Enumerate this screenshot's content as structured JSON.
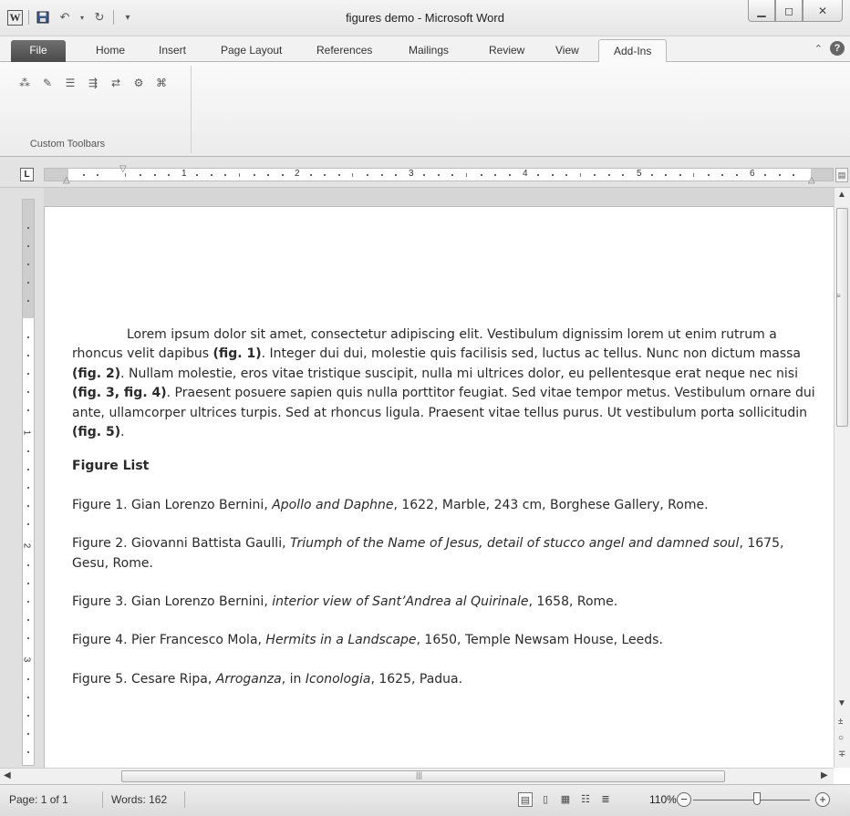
{
  "window": {
    "title": "figures demo - Microsoft Word",
    "app_icon_letter": "W",
    "controls": {
      "minimize": "—",
      "maximize": "▢",
      "close": "✕"
    }
  },
  "quick_access": {
    "save_icon": "save-icon",
    "undo_icon": "undo-icon",
    "redo_icon": "redo-icon",
    "customize_icon": "customize-icon"
  },
  "ribbon": {
    "tabs": [
      "File",
      "Home",
      "Insert",
      "Page Layout",
      "References",
      "Mailings",
      "Review",
      "View",
      "Add-Ins"
    ],
    "active_tab": "Add-Ins",
    "group": {
      "label": "Custom Toolbars"
    },
    "tools": [
      "tool-1-icon",
      "tool-2-icon",
      "tool-3-icon",
      "tool-4-icon",
      "tool-5-icon",
      "tool-6-icon",
      "tool-7-icon"
    ]
  },
  "ruler": {
    "numbers": [
      "1",
      "2",
      "3",
      "4",
      "5",
      "6"
    ],
    "vertical_numbers": [
      "1",
      "2",
      "3"
    ],
    "tab_selector": "L"
  },
  "document": {
    "paragraph": {
      "p1": "Lorem ipsum dolor sit amet, consectetur adipiscing elit. Vestibulum dignissim lorem ut enim rutrum a rhoncus velit dapibus ",
      "ref1": "(fig. 1)",
      "p2": ". Integer dui dui, molestie quis facilisis sed, luctus ac tellus. Nunc non dictum massa ",
      "ref2": "(fig. 2)",
      "p3": ". Nullam molestie, eros vitae tristique suscipit, nulla mi ultrices dolor, eu pellentesque erat neque nec nisi ",
      "ref3": "(fig. 3, fig. 4)",
      "p4": ". Praesent posuere sapien quis nulla porttitor feugiat. Sed vitae tempor metus. Vestibulum ornare dui ante, ullamcorper ultrices turpis. Sed at rhoncus ligula. Praesent vitae tellus purus. Ut vestibulum porta sollicitudin ",
      "ref4": "(fig. 5)",
      "p5": "."
    },
    "figure_list_heading": "Figure List",
    "figures": [
      {
        "prefix": "Figure 1. Gian Lorenzo Bernini, ",
        "title": "Apollo and Daphne",
        "suffix": ", 1622, Marble, 243 cm, Borghese Gallery, Rome."
      },
      {
        "prefix": "Figure 2. Giovanni Battista Gaulli, ",
        "title": "Triumph of the Name of Jesus, detail of stucco angel and damned soul",
        "suffix": ", 1675, Gesu, Rome."
      },
      {
        "prefix": "Figure 3. Gian Lorenzo Bernini, ",
        "title": "interior view of Sant’Andrea al Quirinale",
        "suffix": ", 1658, Rome."
      },
      {
        "prefix": "Figure 4. Pier Francesco Mola, ",
        "title": "Hermits in a Landscape",
        "suffix": ", 1650, Temple Newsam House, Leeds."
      },
      {
        "prefix": "Figure 5. Cesare Ripa, ",
        "title": "Arroganza",
        "mid": ", in ",
        "title2": "Iconologia",
        "suffix": ", 1625, Padua."
      }
    ]
  },
  "status_bar": {
    "page": "Page: 1 of 1",
    "words": "Words: 162",
    "zoom": "110%",
    "zoom_level": 0.55,
    "view_icons": [
      "print-layout-icon",
      "full-screen-reading-icon",
      "web-layout-icon",
      "outline-icon",
      "draft-icon"
    ]
  }
}
